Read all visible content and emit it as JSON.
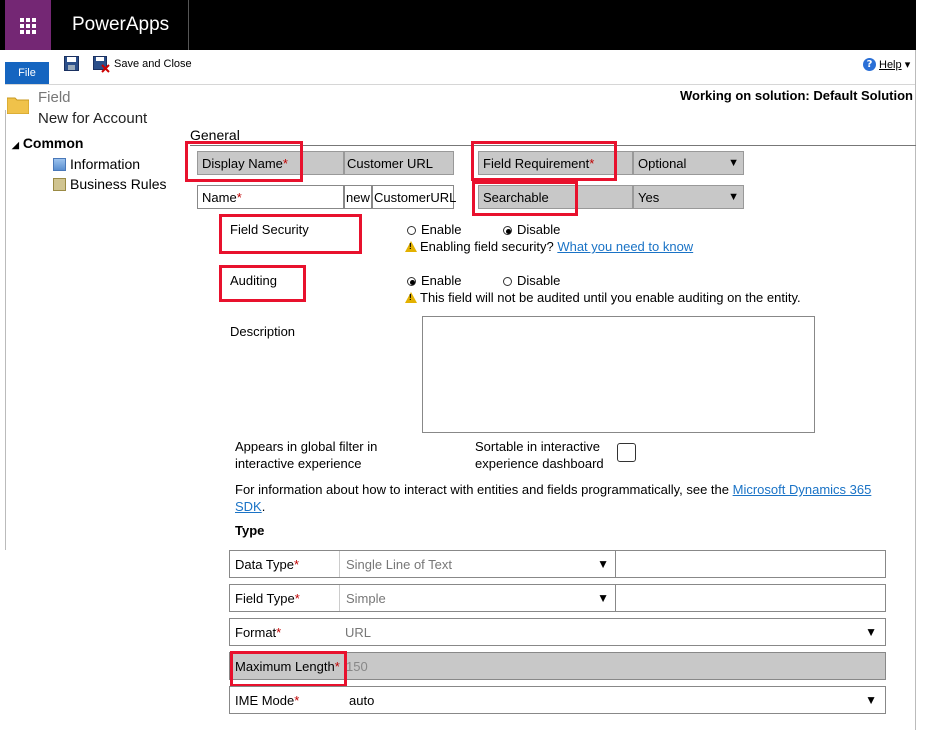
{
  "app": {
    "name": "PowerApps"
  },
  "ribbon": {
    "file_label": "File",
    "save_close_label": "Save and Close",
    "help_label": "Help"
  },
  "header": {
    "entity_label": "Field",
    "title": "New for Account",
    "solution": "Working on solution: Default Solution"
  },
  "nav": {
    "section": "Common",
    "items": [
      {
        "label": "Information"
      },
      {
        "label": "Business Rules"
      }
    ]
  },
  "form": {
    "section": "General",
    "display_name": {
      "label": "Display Name",
      "value": "Customer URL"
    },
    "name": {
      "label": "Name",
      "prefix": "new",
      "value": "CustomerURL"
    },
    "field_requirement": {
      "label": "Field Requirement",
      "value": "Optional"
    },
    "searchable": {
      "label": "Searchable",
      "value": "Yes"
    },
    "field_security": {
      "label": "Field Security",
      "options": [
        "Enable",
        "Disable"
      ],
      "selected": "Disable",
      "warning": "Enabling field security?",
      "link": "What you need to know"
    },
    "auditing": {
      "label": "Auditing",
      "options": [
        "Enable",
        "Disable"
      ],
      "selected": "Enable",
      "warning": "This field will not be audited until you enable auditing on the entity."
    },
    "description": {
      "label": "Description",
      "value": ""
    },
    "global_filter": {
      "line1": "Appears in global filter in",
      "line2": "interactive experience"
    },
    "sortable": {
      "line1": "Sortable in interactive",
      "line2": "experience dashboard",
      "checked": false
    },
    "sdk_note": {
      "text": "For information about how to interact with entities and fields programmatically, see the",
      "link_line1": "Microsoft Dynamics 365",
      "link_line2": "SDK",
      "suffix": "."
    },
    "type_section": "Type",
    "data_type": {
      "label": "Data Type",
      "value": "Single Line of Text"
    },
    "field_type": {
      "label": "Field Type",
      "value": "Simple"
    },
    "format": {
      "label": "Format",
      "value": "URL"
    },
    "max_length": {
      "label": "Maximum Length",
      "value": "150"
    },
    "ime_mode": {
      "label": "IME Mode",
      "value": "auto"
    }
  },
  "colors": {
    "brand": "#742774",
    "topbar": "#000000",
    "file_button": "#1565c0",
    "highlight": "#e8112d",
    "link": "#1a73c6"
  }
}
